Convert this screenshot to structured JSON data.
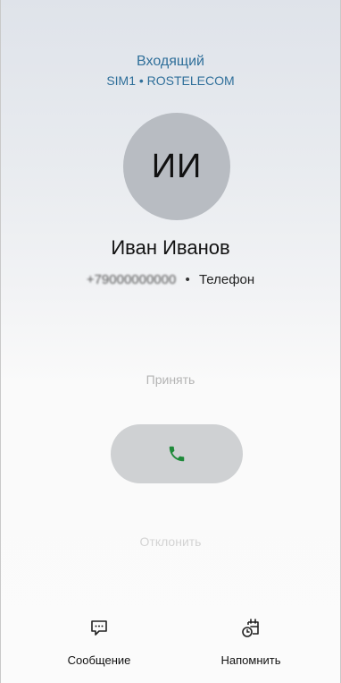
{
  "call": {
    "status": "Входящий",
    "sim_info": "SIM1 • ROSTELECOM"
  },
  "contact": {
    "initials": "ИИ",
    "name": "Иван Иванов",
    "number": "+79000000000",
    "separator": "•",
    "number_type": "Телефон"
  },
  "actions": {
    "accept_label": "Принять",
    "decline_label": "Отклонить",
    "message_label": "Сообщение",
    "remind_label": "Напомнить"
  },
  "icons": {
    "phone": "phone-icon",
    "message": "message-bubble-icon",
    "remind": "calendar-clock-icon"
  },
  "colors": {
    "accent": "#2f6f9a",
    "accept_green": "#1f8a3a",
    "avatar_bg": "#b8bcc2",
    "slider_bg": "#cfd1d3"
  }
}
